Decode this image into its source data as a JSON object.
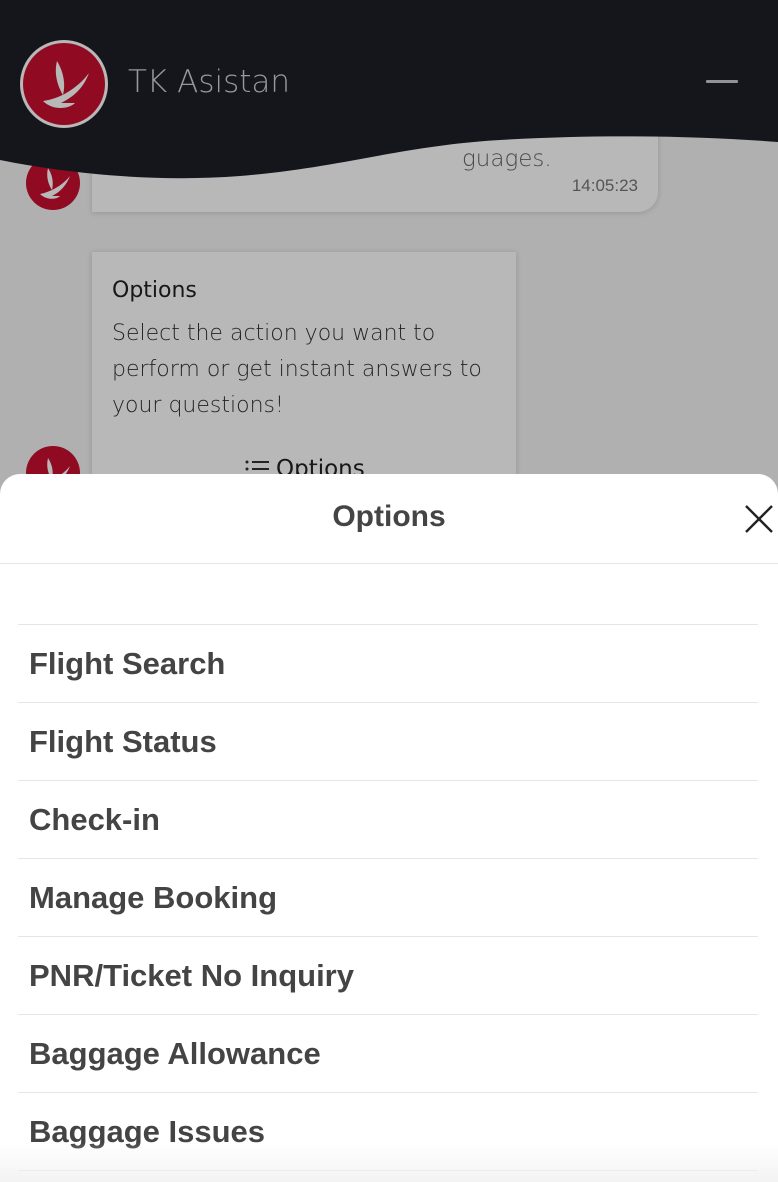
{
  "header": {
    "title": "TK Asistan",
    "logo_icon": "turkish-airlines-logo",
    "minimize_icon": "minimize-icon",
    "background_color": "#1c1f26",
    "brand_color": "#c8102e"
  },
  "chat": {
    "message_1": {
      "partial_text": "guages.",
      "time": "14:05:23"
    },
    "message_2": {
      "title": "Options",
      "text": "Select the action you want to perform or get instant answers to your questions!",
      "button_label": "Options",
      "button_icon": "list-icon"
    }
  },
  "sheet": {
    "title": "Options",
    "close_icon": "close-icon",
    "items": [
      {
        "label": "Flight Search"
      },
      {
        "label": "Flight Status"
      },
      {
        "label": "Check-in"
      },
      {
        "label": "Manage Booking"
      },
      {
        "label": "PNR/Ticket No Inquiry"
      },
      {
        "label": "Baggage Allowance"
      },
      {
        "label": "Baggage Issues"
      }
    ]
  }
}
